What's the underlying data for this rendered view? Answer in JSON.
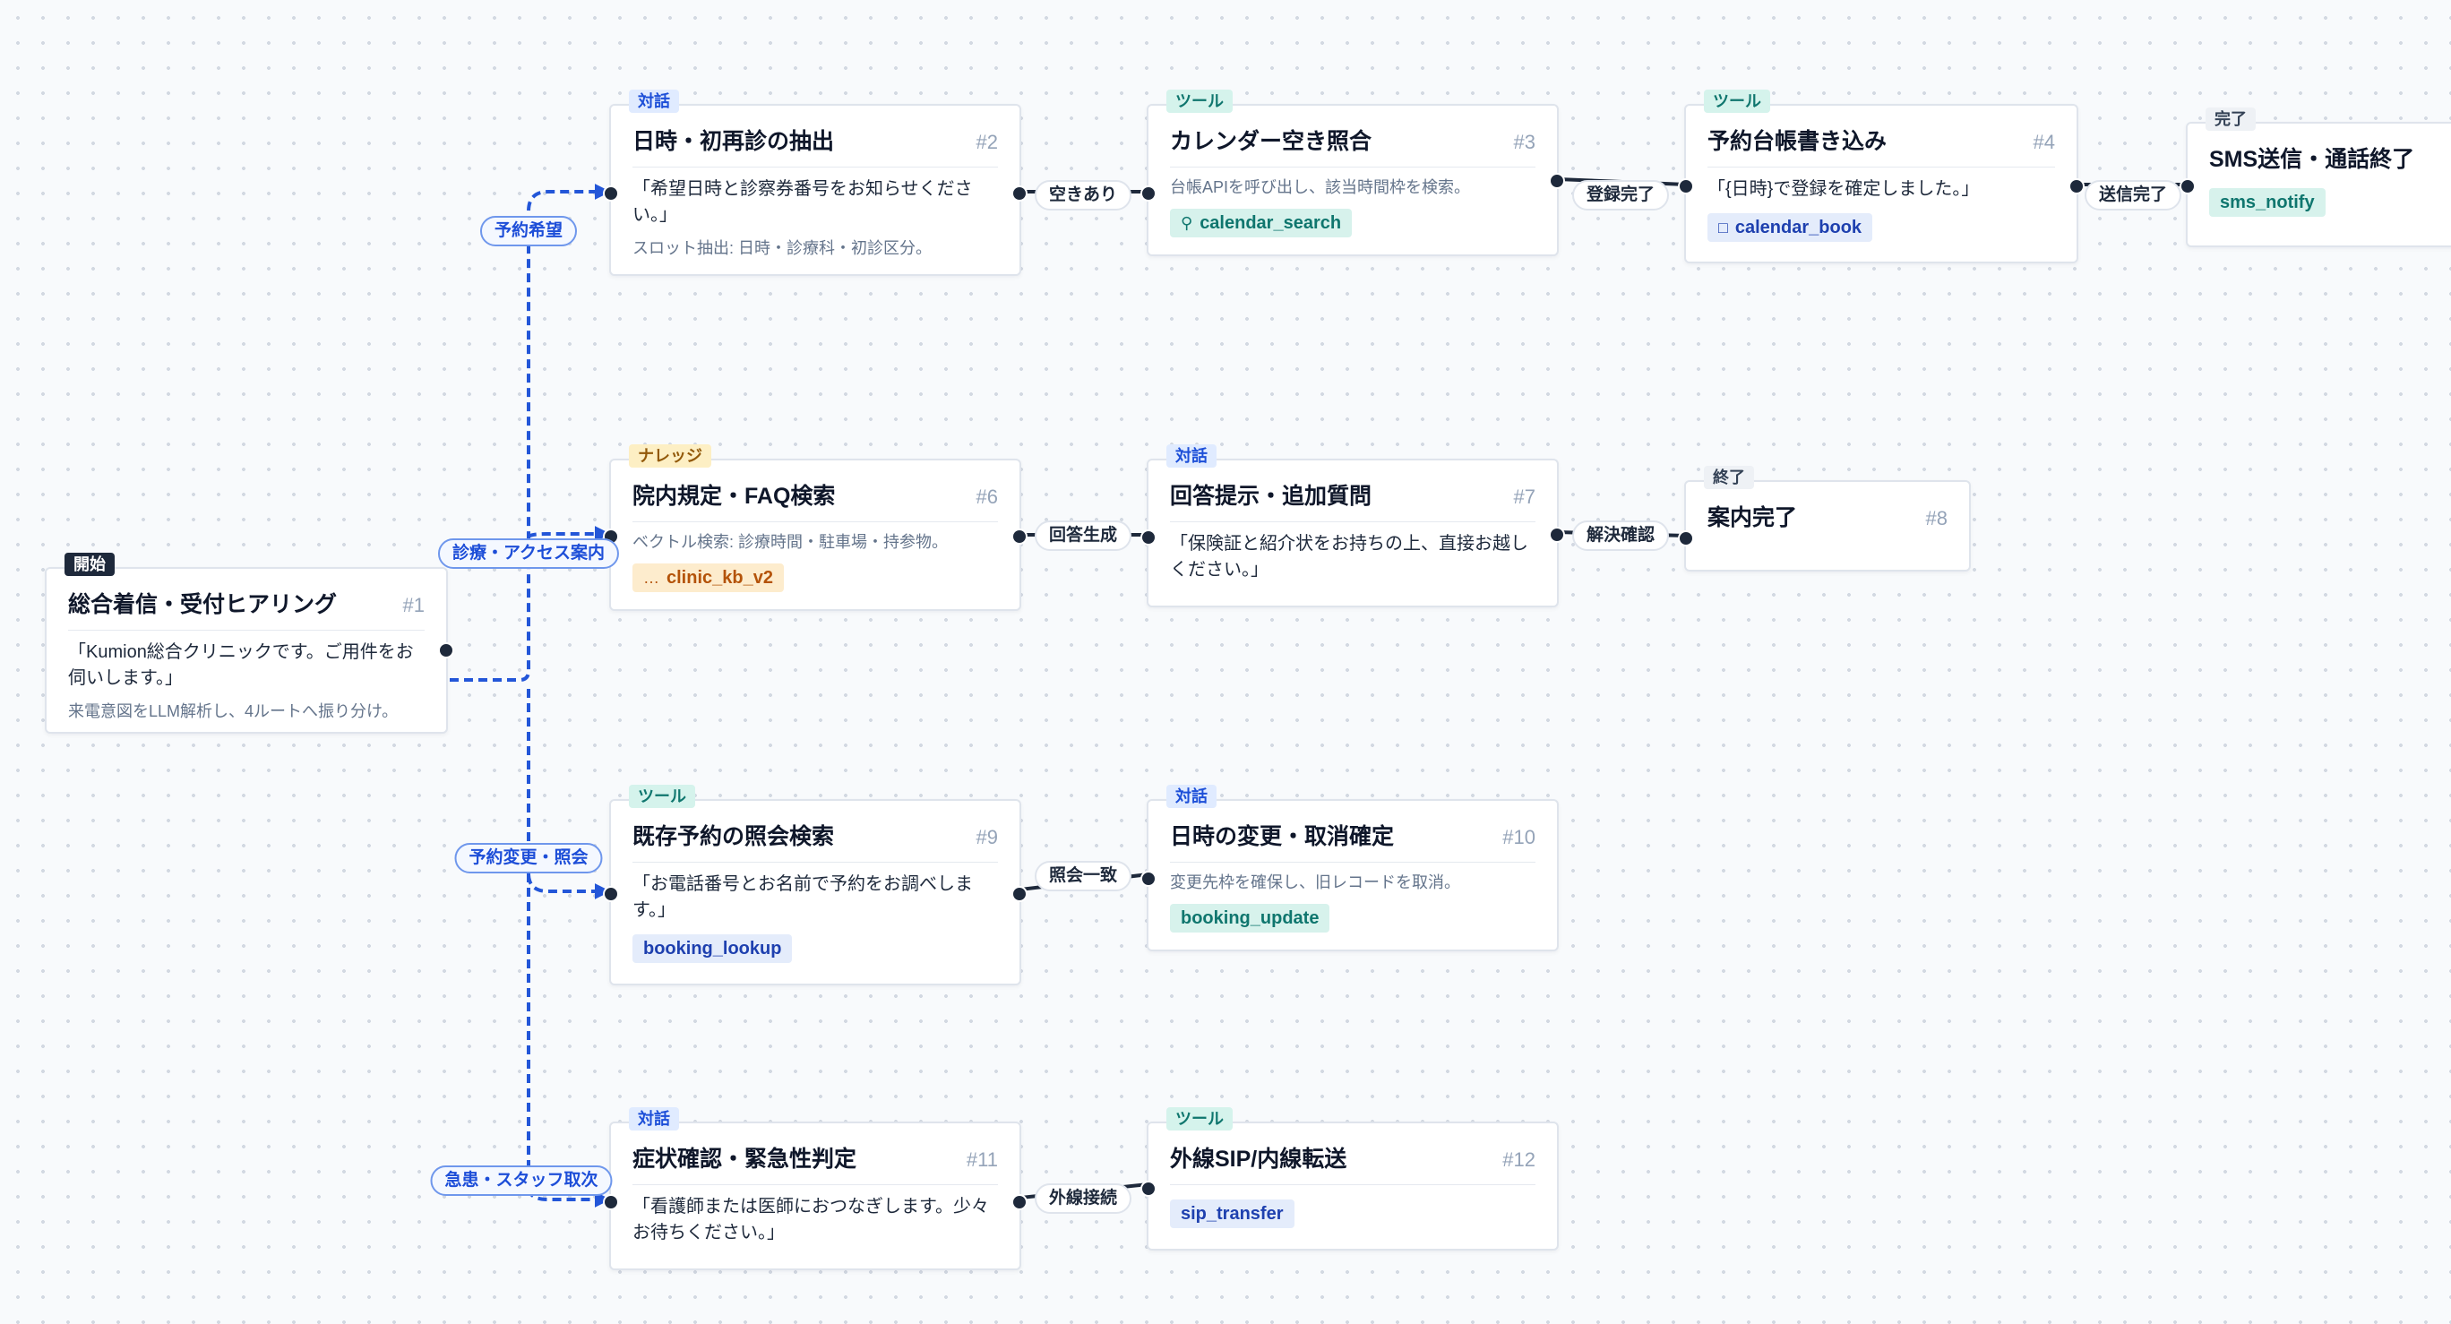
{
  "colors": {
    "branch_edge": "#2356d8",
    "solid_edge": "#1e293b",
    "node_border": "#dfe4ec"
  },
  "nodes": {
    "n1": {
      "tag": "開始",
      "title": "総合着信・受付ヒアリング",
      "num": "#1",
      "quote": "「Kumion総合クリニックです。ご用件をお伺いします。」",
      "sub": "来電意図をLLM解析し、4ルートへ振り分け。"
    },
    "n2": {
      "tag": "対話",
      "title": "日時・初再診の抽出",
      "num": "#2",
      "quote": "「希望日時と診察券番号をお知らせください。」",
      "sub": "スロット抽出: 日時・診療科・初診区分。"
    },
    "n3": {
      "tag": "ツール",
      "title": "カレンダー空き照合",
      "num": "#3",
      "sub": "台帳APIを呼び出し、該当時間枠を検索。",
      "chip": "calendar_search",
      "chip_icon": "search-icon"
    },
    "n4": {
      "tag": "ツール",
      "title": "予約台帳書き込み",
      "num": "#4",
      "quote": "「{日時}で登録を確定しました。」",
      "chip": "calendar_book",
      "chip_icon": "book-icon"
    },
    "n5": {
      "tag": "完了",
      "title": "SMS送信・通話終了",
      "chip": "sms_notify"
    },
    "n6": {
      "tag": "ナレッジ",
      "title": "院内規定・FAQ検索",
      "num": "#6",
      "sub": "ベクトル検索: 診療時間・駐車場・持参物。",
      "chip": "clinic_kb_v2",
      "chip_icon": "knowledge-icon"
    },
    "n7": {
      "tag": "対話",
      "title": "回答提示・追加質問",
      "num": "#7",
      "quote": "「保険証と紹介状をお持ちの上、直接お越しください。」"
    },
    "n8": {
      "tag": "終了",
      "title": "案内完了",
      "num": "#8"
    },
    "n9": {
      "tag": "ツール",
      "title": "既存予約の照会検索",
      "num": "#9",
      "quote": "「お電話番号とお名前で予約をお調べします。」",
      "chip": "booking_lookup"
    },
    "n10": {
      "tag": "対話",
      "title": "日時の変更・取消確定",
      "num": "#10",
      "sub": "変更先枠を確保し、旧レコードを取消。",
      "chip": "booking_update"
    },
    "n11": {
      "tag": "対話",
      "title": "症状確認・緊急性判定",
      "num": "#11",
      "quote": "「看護師または医師におつなぎします。少々お待ちください。」"
    },
    "n12": {
      "tag": "ツール",
      "title": "外線SIP/内線転送",
      "num": "#12",
      "chip": "sip_transfer"
    }
  },
  "edges": {
    "e1_2": "予約希望",
    "e1_6": "診療・アクセス案内",
    "e1_9": "予約変更・照会",
    "e1_11": "急患・スタッフ取次",
    "e2_3": "空きあり",
    "e3_4": "登録完了",
    "e4_5": "送信完了",
    "e6_7": "回答生成",
    "e7_8": "解決確認",
    "e9_10": "照会一致",
    "e11_12": "外線接続"
  }
}
